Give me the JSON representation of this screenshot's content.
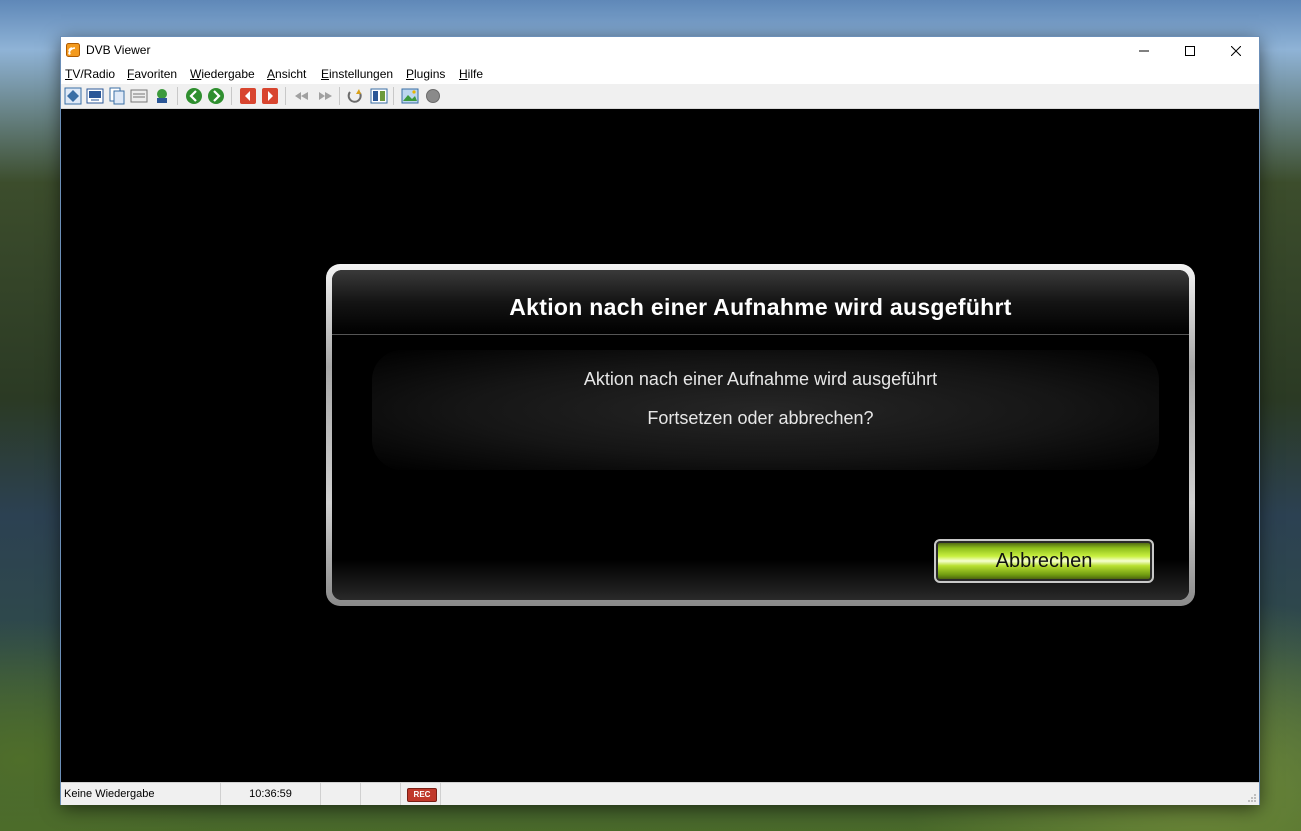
{
  "window": {
    "title": "DVB Viewer"
  },
  "menu": {
    "items": [
      {
        "accel": "T",
        "rest": "V/Radio"
      },
      {
        "accel": "F",
        "rest": "avoriten"
      },
      {
        "accel": "W",
        "rest": "iedergabe"
      },
      {
        "accel": "A",
        "rest": "nsicht"
      },
      {
        "accel": "E",
        "rest": "instellungen"
      },
      {
        "accel": "P",
        "rest": "lugins"
      },
      {
        "accel": "H",
        "rest": "ilfe"
      }
    ]
  },
  "toolbar": {
    "icons": [
      "channel-list-icon",
      "osd-icon",
      "copy-icon",
      "epg-icon",
      "favorites-icon",
      "back-icon",
      "forward-icon",
      "prev-channel-icon",
      "next-channel-icon",
      "rewind-icon",
      "fast-forward-icon",
      "refresh-icon",
      "recording-list-icon",
      "image-icon",
      "record-icon"
    ]
  },
  "osd": {
    "title": "Aktion nach einer Aufnahme wird ausgeführt",
    "line1": "Aktion nach einer Aufnahme wird ausgeführt",
    "line2": "Fortsetzen oder abbrechen?",
    "cancel_label": "Abbrechen"
  },
  "status": {
    "playback": "Keine Wiedergabe",
    "time": "10:36:59",
    "rec": "REC"
  },
  "colors": {
    "accent_green": "#b8e030",
    "rec_red": "#c0392b",
    "video_bg": "#000000"
  }
}
